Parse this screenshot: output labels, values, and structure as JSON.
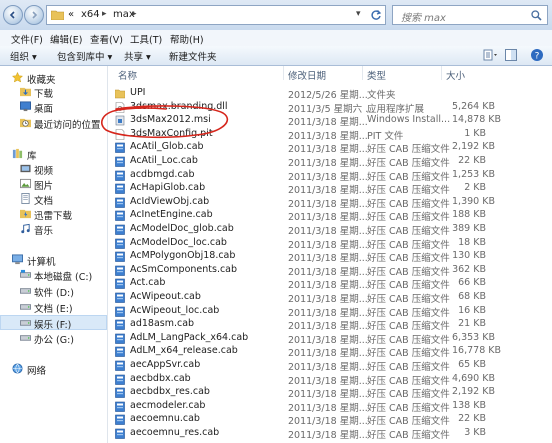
{
  "address": {
    "prefix": "«",
    "segment1": "x64",
    "segment2": "max"
  },
  "search": {
    "placeholder": "搜索 max"
  },
  "menu": [
    "文件(F)",
    "编辑(E)",
    "查看(V)",
    "工具(T)",
    "帮助(H)"
  ],
  "toolbar": {
    "organize": "组织 ▾",
    "include": "包含到库中 ▾",
    "share": "共享 ▾",
    "new_folder": "新建文件夹"
  },
  "sidebar": {
    "favorites": "收藏夹",
    "fav_items": [
      "下载",
      "桌面",
      "最近访问的位置"
    ],
    "libraries": "库",
    "lib_items": [
      "视频",
      "图片",
      "文档",
      "迅雷下载",
      "音乐"
    ],
    "computer": "计算机",
    "drives": [
      "本地磁盘 (C:)",
      "软件 (D:)",
      "文档 (E:)",
      "娱乐 (F:)",
      "办公 (G:)"
    ],
    "network": "网络"
  },
  "columns": {
    "name": "名称",
    "date": "修改日期",
    "type": "类型",
    "size": "大小"
  },
  "files": [
    {
      "name": "UPI",
      "date": "2012/5/26 星期...",
      "type": "文件夹",
      "size": "",
      "kind": "folder"
    },
    {
      "name": "3dsmax.branding.dll",
      "date": "2011/3/5 星期六 ...",
      "type": "应用程序扩展",
      "size": "5,264 KB",
      "kind": "dll"
    },
    {
      "name": "3dsMax2012.msi",
      "date": "2011/3/18 星期...",
      "type": "Windows Install...",
      "size": "14,878 KB",
      "kind": "msi"
    },
    {
      "name": "3dsMaxConfig.pit",
      "date": "2011/3/18 星期...",
      "type": "PIT 文件",
      "size": "1 KB",
      "kind": "file"
    },
    {
      "name": "AcAtil_Glob.cab",
      "date": "2011/3/18 星期...",
      "type": "好压 CAB 压缩文件",
      "size": "2,192 KB",
      "kind": "cab"
    },
    {
      "name": "AcAtil_Loc.cab",
      "date": "2011/3/18 星期...",
      "type": "好压 CAB 压缩文件",
      "size": "22 KB",
      "kind": "cab"
    },
    {
      "name": "acdbmgd.cab",
      "date": "2011/3/18 星期...",
      "type": "好压 CAB 压缩文件",
      "size": "1,253 KB",
      "kind": "cab"
    },
    {
      "name": "AcHapiGlob.cab",
      "date": "2011/3/18 星期...",
      "type": "好压 CAB 压缩文件",
      "size": "2 KB",
      "kind": "cab"
    },
    {
      "name": "AcIdViewObj.cab",
      "date": "2011/3/18 星期...",
      "type": "好压 CAB 压缩文件",
      "size": "1,390 KB",
      "kind": "cab"
    },
    {
      "name": "AcInetEngine.cab",
      "date": "2011/3/18 星期...",
      "type": "好压 CAB 压缩文件",
      "size": "188 KB",
      "kind": "cab"
    },
    {
      "name": "AcModelDoc_glob.cab",
      "date": "2011/3/18 星期...",
      "type": "好压 CAB 压缩文件",
      "size": "389 KB",
      "kind": "cab"
    },
    {
      "name": "AcModelDoc_loc.cab",
      "date": "2011/3/18 星期...",
      "type": "好压 CAB 压缩文件",
      "size": "18 KB",
      "kind": "cab"
    },
    {
      "name": "AcMPolygonObj18.cab",
      "date": "2011/3/18 星期...",
      "type": "好压 CAB 压缩文件",
      "size": "130 KB",
      "kind": "cab"
    },
    {
      "name": "AcSmComponents.cab",
      "date": "2011/3/18 星期...",
      "type": "好压 CAB 压缩文件",
      "size": "362 KB",
      "kind": "cab"
    },
    {
      "name": "Act.cab",
      "date": "2011/3/18 星期...",
      "type": "好压 CAB 压缩文件",
      "size": "66 KB",
      "kind": "cab"
    },
    {
      "name": "AcWipeout.cab",
      "date": "2011/3/18 星期...",
      "type": "好压 CAB 压缩文件",
      "size": "68 KB",
      "kind": "cab"
    },
    {
      "name": "AcWipeout_loc.cab",
      "date": "2011/3/18 星期...",
      "type": "好压 CAB 压缩文件",
      "size": "16 KB",
      "kind": "cab"
    },
    {
      "name": "ad18asm.cab",
      "date": "2011/3/18 星期...",
      "type": "好压 CAB 压缩文件",
      "size": "21 KB",
      "kind": "cab"
    },
    {
      "name": "AdLM_LangPack_x64.cab",
      "date": "2011/3/18 星期...",
      "type": "好压 CAB 压缩文件",
      "size": "6,353 KB",
      "kind": "cab"
    },
    {
      "name": "AdLM_x64_release.cab",
      "date": "2011/3/18 星期...",
      "type": "好压 CAB 压缩文件",
      "size": "16,778 KB",
      "kind": "cab"
    },
    {
      "name": "aecAppSvr.cab",
      "date": "2011/3/18 星期...",
      "type": "好压 CAB 压缩文件",
      "size": "65 KB",
      "kind": "cab"
    },
    {
      "name": "aecbdbx.cab",
      "date": "2011/3/18 星期...",
      "type": "好压 CAB 压缩文件",
      "size": "4,690 KB",
      "kind": "cab"
    },
    {
      "name": "aecbdbx_res.cab",
      "date": "2011/3/18 星期...",
      "type": "好压 CAB 压缩文件",
      "size": "2,192 KB",
      "kind": "cab"
    },
    {
      "name": "aecmodeler.cab",
      "date": "2011/3/18 星期...",
      "type": "好压 CAB 压缩文件",
      "size": "138 KB",
      "kind": "cab"
    },
    {
      "name": "aecoemnu.cab",
      "date": "2011/3/18 星期...",
      "type": "好压 CAB 压缩文件",
      "size": "22 KB",
      "kind": "cab"
    },
    {
      "name": "aecoemnu_res.cab",
      "date": "2011/3/18 星期...",
      "type": "好压 CAB 压缩文件",
      "size": "3 KB",
      "kind": "cab"
    }
  ],
  "colors": {
    "annotation": "#d6261c",
    "selection": "#d9e9f8",
    "header_text": "#4c607a"
  }
}
